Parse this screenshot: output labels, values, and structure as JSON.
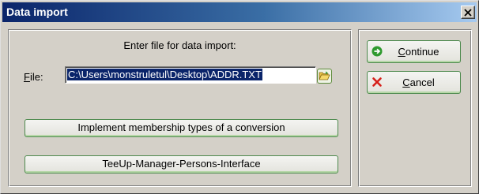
{
  "window": {
    "title": "Data import",
    "close_symbol": "✕"
  },
  "main": {
    "prompt": "Enter file for data import:",
    "file_label_prefix": "F",
    "file_label_rest": "ile:",
    "file_value": "C:\\Users\\monstruletul\\Desktop\\ADDR.TXT",
    "browse_icon": "folder-open-icon",
    "membership_button": "Implement membership types of a conversion",
    "interface_button": "TeeUp-Manager-Persons-Interface"
  },
  "actions": {
    "continue_prefix": "C",
    "continue_rest": "ontinue",
    "continue_icon": "arrow-right-icon",
    "cancel_prefix": "C",
    "cancel_rest": "ancel",
    "cancel_icon": "red-x-icon"
  },
  "colors": {
    "titlebar_start": "#0a246a",
    "titlebar_end": "#a6caf0",
    "button_border": "#4e8a4e",
    "selection": "#0a246a",
    "cancel_icon": "#d6201a",
    "continue_icon": "#2f9a2f"
  }
}
